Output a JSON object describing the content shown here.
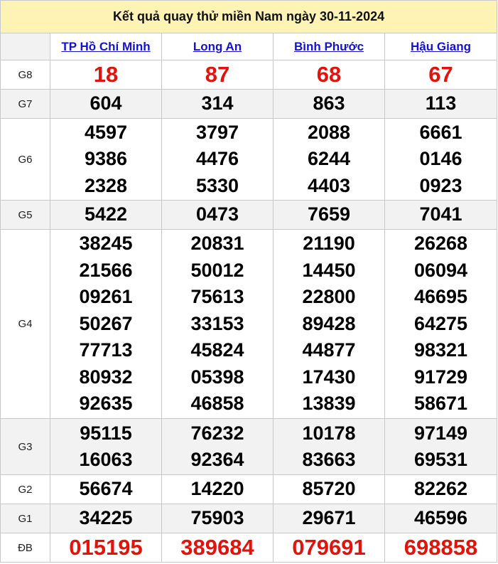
{
  "title": "Kết quả quay thử miền Nam ngày 30-11-2024",
  "provinces": [
    "TP Hồ Chí Minh",
    "Long An",
    "Bình Phước",
    "Hậu Giang"
  ],
  "prizes": [
    {
      "label": "G8",
      "values": [
        [
          "18"
        ],
        [
          "87"
        ],
        [
          "68"
        ],
        [
          "67"
        ]
      ]
    },
    {
      "label": "G7",
      "values": [
        [
          "604"
        ],
        [
          "314"
        ],
        [
          "863"
        ],
        [
          "113"
        ]
      ]
    },
    {
      "label": "G6",
      "values": [
        [
          "4597",
          "9386",
          "2328"
        ],
        [
          "3797",
          "4476",
          "5330"
        ],
        [
          "2088",
          "6244",
          "4403"
        ],
        [
          "6661",
          "0146",
          "0923"
        ]
      ]
    },
    {
      "label": "G5",
      "values": [
        [
          "5422"
        ],
        [
          "0473"
        ],
        [
          "7659"
        ],
        [
          "7041"
        ]
      ]
    },
    {
      "label": "G4",
      "values": [
        [
          "38245",
          "21566",
          "09261",
          "50267",
          "77713",
          "80932",
          "92635"
        ],
        [
          "20831",
          "50012",
          "75613",
          "33153",
          "45824",
          "05398",
          "46858"
        ],
        [
          "21190",
          "14450",
          "22800",
          "89428",
          "44877",
          "17430",
          "13839"
        ],
        [
          "26268",
          "06094",
          "46695",
          "64275",
          "98321",
          "91729",
          "58671"
        ]
      ]
    },
    {
      "label": "G3",
      "values": [
        [
          "95115",
          "16063"
        ],
        [
          "76232",
          "92364"
        ],
        [
          "10178",
          "83663"
        ],
        [
          "97149",
          "69531"
        ]
      ]
    },
    {
      "label": "G2",
      "values": [
        [
          "56674"
        ],
        [
          "14220"
        ],
        [
          "85720"
        ],
        [
          "82262"
        ]
      ]
    },
    {
      "label": "G1",
      "values": [
        [
          "34225"
        ],
        [
          "75903"
        ],
        [
          "29671"
        ],
        [
          "46596"
        ]
      ]
    },
    {
      "label": "ĐB",
      "values": [
        [
          "015195"
        ],
        [
          "389684"
        ],
        [
          "079691"
        ],
        [
          "698858"
        ]
      ]
    }
  ],
  "colors": {
    "special": "#e3120b",
    "link": "#1212d6",
    "title_bg": "#fdf3b4",
    "shade_bg": "#f2f2f2"
  }
}
